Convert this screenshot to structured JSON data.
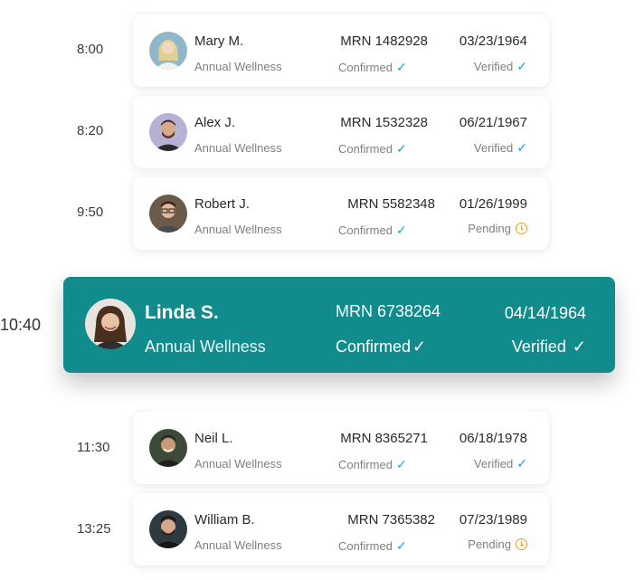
{
  "appointments": [
    {
      "time": "8:00",
      "name": "Mary M.",
      "visit_type": "Annual Wellness",
      "mrn": "MRN 1482928",
      "dob": "03/23/1964",
      "appointment_status": "Confirmed",
      "insurance_status": "Verified",
      "insurance_icon": "check-icon",
      "avatar_color": "#8fb7c9"
    },
    {
      "time": "8:20",
      "name": "Alex J.",
      "visit_type": "Annual Wellness",
      "mrn": "MRN 1532328",
      "dob": "06/21/1967",
      "appointment_status": "Confirmed",
      "insurance_status": "Verified",
      "insurance_icon": "check-icon",
      "avatar_color": "#b8b1d6"
    },
    {
      "time": "9:50",
      "name": "Robert J.",
      "visit_type": "Annual Wellness",
      "mrn": "MRN 5582348",
      "dob": "01/26/1999",
      "appointment_status": "Confirmed",
      "insurance_status": "Pending",
      "insurance_icon": "clock-icon",
      "avatar_color": "#6a5a4a"
    },
    {
      "time": "11:30",
      "name": "Neil L.",
      "visit_type": "Annual Wellness",
      "mrn": "MRN 8365271",
      "dob": "06/18/1978",
      "appointment_status": "Confirmed",
      "insurance_status": "Verified",
      "insurance_icon": "check-icon",
      "avatar_color": "#3d4a3a"
    },
    {
      "time": "13:25",
      "name": "William B.",
      "visit_type": "Annual Wellness",
      "mrn": "MRN 7365382",
      "dob": "07/23/1989",
      "appointment_status": "Confirmed",
      "insurance_status": "Pending",
      "insurance_icon": "clock-icon",
      "avatar_color": "#2e3a40"
    }
  ],
  "highlighted": {
    "time": "10:40",
    "name": "Linda S.",
    "visit_type": "Annual Wellness",
    "mrn": "MRN 6738264",
    "dob": "04/14/1964",
    "appointment_status": "Confirmed",
    "insurance_status": "Verified",
    "insurance_icon": "check-icon",
    "avatar_color": "#c9b7a8"
  },
  "colors": {
    "highlight_bg": "#118b8b",
    "check": "#1aa3e6",
    "pending": "#f0982e"
  }
}
